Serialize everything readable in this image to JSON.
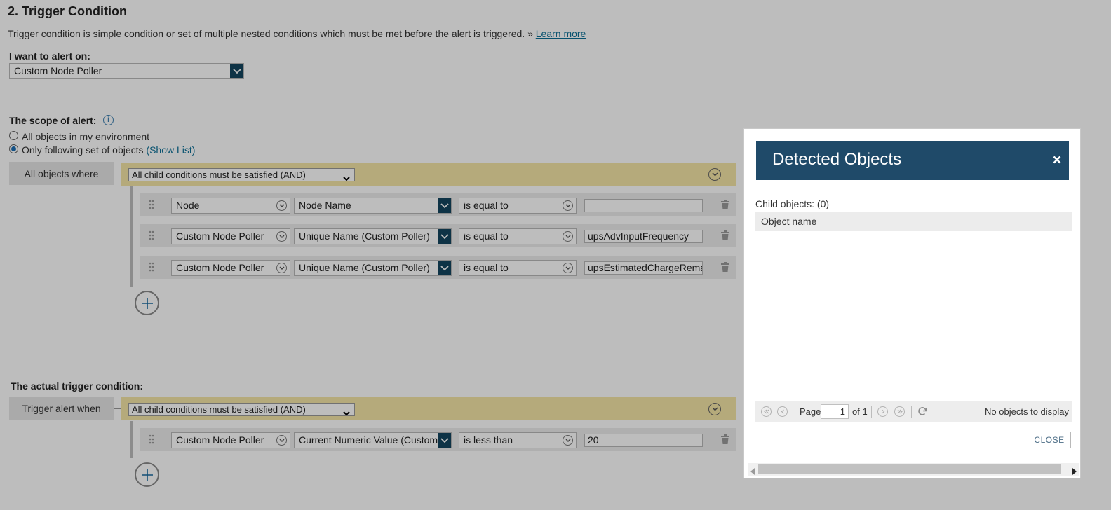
{
  "section": {
    "title": "2. Trigger Condition",
    "intro": "Trigger condition is simple condition or set of multiple nested conditions which must be met before the alert is triggered. »",
    "learn_more": "Learn more"
  },
  "alert_on": {
    "label": "I want to alert on:",
    "value": "Custom Node Poller"
  },
  "scope": {
    "label": "The scope of alert:",
    "option_all": "All objects in my environment",
    "option_following": "Only following set of objects",
    "show_list": "(Show List)",
    "selected": "Only following set of objects",
    "where_label": "All objects where",
    "group_operator": "All child conditions must be satisfied (AND)",
    "conditions": [
      {
        "entity": "Node",
        "field": "Node Name",
        "operator": "is equal to",
        "value": ""
      },
      {
        "entity": "Custom Node Poller",
        "field": "Unique Name (Custom Poller)",
        "operator": "is equal to",
        "value": "upsAdvInputFrequency"
      },
      {
        "entity": "Custom Node Poller",
        "field": "Unique Name (Custom Poller)",
        "operator": "is equal to",
        "value": "upsEstimatedChargeRemair"
      }
    ]
  },
  "trigger": {
    "label": "The actual trigger condition:",
    "when_label": "Trigger alert when",
    "group_operator": "All child conditions must be satisfied (AND)",
    "conditions": [
      {
        "entity": "Custom Node Poller",
        "field": "Current Numeric Value (Custom F",
        "operator": "is less than",
        "value": "20"
      }
    ]
  },
  "modal": {
    "title": "Detected Objects",
    "child_objects": "Child objects: (0)",
    "column_header": "Object name",
    "pager": {
      "page_label": "Page",
      "page_value": "1",
      "of_label": "of 1",
      "status": "No objects to display"
    },
    "close_label": "CLOSE"
  },
  "colors": {
    "modal_header": "#1f4a69",
    "and_bar": "#f5e6a6",
    "dropdown_button": "#14465f",
    "link": "#0b6f96"
  }
}
